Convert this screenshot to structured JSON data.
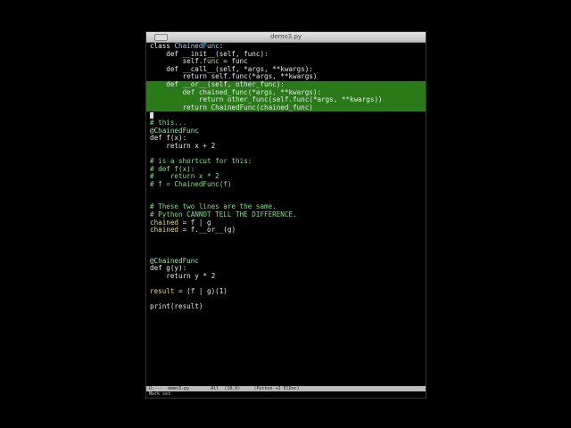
{
  "window": {
    "title": "demo3.py"
  },
  "editor": {
    "lines": [
      [
        [
          "class ",
          "kw"
        ],
        [
          "ChainedFunc",
          "cls"
        ],
        [
          ":",
          ""
        ]
      ],
      [
        [
          "    def __init__(self, func):",
          ""
        ]
      ],
      [
        [
          "        self.",
          ""
        ],
        [
          "func",
          "at"
        ],
        [
          " = func",
          ""
        ]
      ],
      [
        [
          "    def __call__(self, *args, **kwargs):",
          ""
        ]
      ],
      [
        [
          "        return self.func(*args, **kwargs)",
          ""
        ]
      ],
      {
        "hl": true,
        "segs": [
          [
            "    def __or__(self, other_func):",
            ""
          ]
        ]
      },
      {
        "hl": true,
        "segs": [
          [
            "        def chained_func(*args, **kwargs):",
            ""
          ]
        ]
      },
      {
        "hl": true,
        "segs": [
          [
            "            return other_func(self.func(*args, **kwargs))",
            ""
          ]
        ]
      },
      {
        "hl": true,
        "segs": [
          [
            "        return ChainedFunc(chained_func)",
            ""
          ]
        ]
      },
      {
        "cursor": true,
        "segs": []
      },
      [
        [
          "# this...",
          "cm"
        ]
      ],
      [
        [
          "@ChainedFunc",
          "dec"
        ]
      ],
      [
        [
          "def f(x):",
          ""
        ]
      ],
      [
        [
          "    return x + 2",
          ""
        ]
      ],
      [],
      [
        [
          "# is a shortcut for this:",
          "cm"
        ]
      ],
      [
        [
          "# def f(x):",
          "cm"
        ]
      ],
      [
        [
          "#    return x * 2",
          "cm"
        ]
      ],
      [
        [
          "# f = ChainedFunc(f)",
          "cm"
        ]
      ],
      [],
      [],
      [
        [
          "# These two lines are the same.",
          "cm"
        ]
      ],
      [
        [
          "# Python CANNOT TELL THE DIFFERENCE.",
          "cm"
        ]
      ],
      [
        [
          "chained",
          "var"
        ],
        [
          " = f | g",
          ""
        ]
      ],
      [
        [
          "chained",
          "var"
        ],
        [
          " = f.__or__(g)",
          ""
        ]
      ],
      [],
      [],
      [],
      [
        [
          "@ChainedFunc",
          "dec"
        ]
      ],
      [
        [
          "def g(y):",
          ""
        ]
      ],
      [
        [
          "    return y * 2",
          ""
        ]
      ],
      [],
      [
        [
          "result",
          "var"
        ],
        [
          " = (f | g)(1)",
          ""
        ]
      ],
      [],
      [
        [
          "print(result)",
          ""
        ]
      ]
    ]
  },
  "modeline": {
    "status": "U:---",
    "buffer": "demo3.py",
    "position": "All",
    "line_col": "(10,0)",
    "modes": "(Python +2 ElDoc)"
  },
  "minibuffer": {
    "message": "Mark set"
  }
}
